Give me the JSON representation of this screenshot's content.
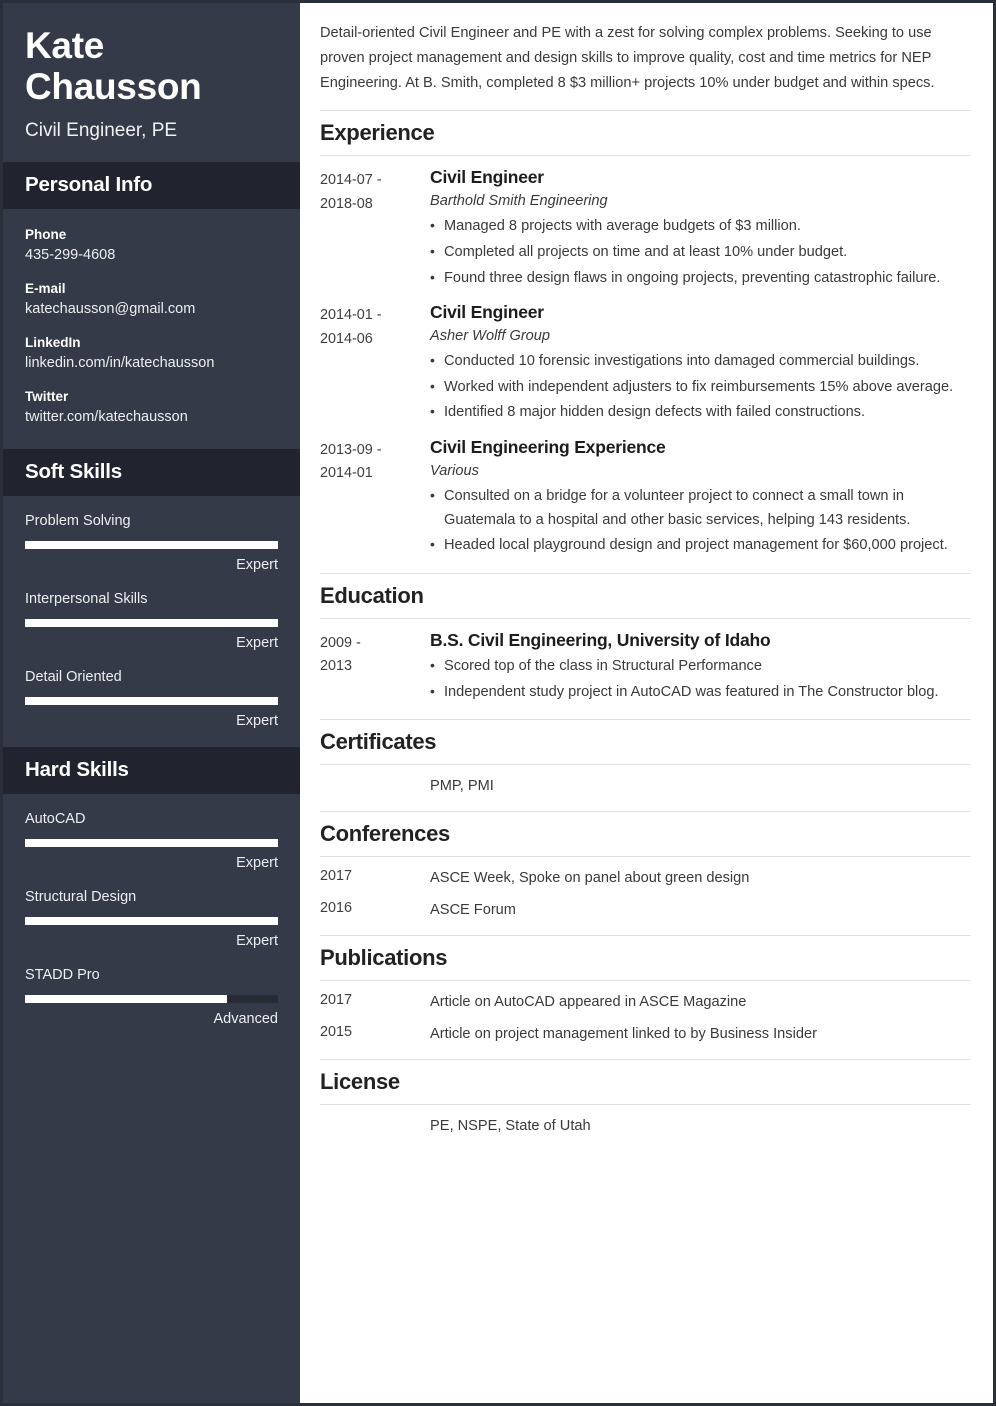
{
  "sidebar": {
    "name": "Kate Chausson",
    "job_title": "Civil Engineer, PE",
    "personal_info": {
      "heading": "Personal Info",
      "items": [
        {
          "label": "Phone",
          "value": "435-299-4608"
        },
        {
          "label": "E-mail",
          "value": "katechausson@gmail.com"
        },
        {
          "label": "LinkedIn",
          "value": "linkedin.com/in/katechausson"
        },
        {
          "label": "Twitter",
          "value": "twitter.com/katechausson"
        }
      ]
    },
    "soft_skills": {
      "heading": "Soft Skills",
      "items": [
        {
          "name": "Problem Solving",
          "level": "Expert",
          "percent": 100
        },
        {
          "name": "Interpersonal Skills",
          "level": "Expert",
          "percent": 100
        },
        {
          "name": "Detail Oriented",
          "level": "Expert",
          "percent": 100
        }
      ]
    },
    "hard_skills": {
      "heading": "Hard Skills",
      "items": [
        {
          "name": "AutoCAD",
          "level": "Expert",
          "percent": 100
        },
        {
          "name": "Structural Design",
          "level": "Expert",
          "percent": 100
        },
        {
          "name": "STADD Pro",
          "level": "Advanced",
          "percent": 80
        }
      ]
    }
  },
  "main": {
    "summary": "Detail-oriented Civil Engineer and PE with a zest for solving complex problems. Seeking to use proven project management and design skills to improve quality, cost and time metrics for NEP Engineering. At B. Smith, completed 8 $3 million+ projects 10% under budget and within specs.",
    "experience": {
      "heading": "Experience",
      "entries": [
        {
          "date_start": "2014-07 -",
          "date_end": "2018-08",
          "title": "Civil Engineer",
          "org": "Barthold Smith Engineering",
          "bullets": [
            "Managed 8 projects with average budgets of $3 million.",
            "Completed all projects on time and at least 10% under budget.",
            "Found three design flaws in ongoing projects, preventing catastrophic failure."
          ]
        },
        {
          "date_start": "2014-01 -",
          "date_end": "2014-06",
          "title": "Civil Engineer",
          "org": "Asher Wolff Group",
          "bullets": [
            "Conducted 10 forensic investigations into damaged commercial buildings.",
            "Worked with independent adjusters to fix reimbursements 15% above average.",
            "Identified 8 major hidden design defects with failed constructions."
          ]
        },
        {
          "date_start": "2013-09 -",
          "date_end": "2014-01",
          "title": "Civil Engineering Experience",
          "org": "Various",
          "bullets": [
            "Consulted on a bridge for a volunteer project to connect a small town in Guatemala to a hospital and other basic services, helping 143 residents.",
            "Headed local playground design and project management for $60,000 project."
          ]
        }
      ]
    },
    "education": {
      "heading": "Education",
      "entries": [
        {
          "date_start": "2009 -",
          "date_end": "2013",
          "title": "B.S. Civil Engineering, University of Idaho",
          "bullets": [
            "Scored top of the class in Structural Performance",
            "Independent study project in AutoCAD was featured in The Constructor blog."
          ]
        }
      ]
    },
    "certificates": {
      "heading": "Certificates",
      "entries": [
        {
          "date": "",
          "text": "PMP, PMI"
        }
      ]
    },
    "conferences": {
      "heading": "Conferences",
      "entries": [
        {
          "date": "2017",
          "text": "ASCE Week, Spoke on panel about green design"
        },
        {
          "date": "2016",
          "text": "ASCE Forum"
        }
      ]
    },
    "publications": {
      "heading": "Publications",
      "entries": [
        {
          "date": "2017",
          "text": "Article on AutoCAD appeared in ASCE Magazine"
        },
        {
          "date": "2015",
          "text": "Article on project management linked to by Business Insider"
        }
      ]
    },
    "license": {
      "heading": "License",
      "entries": [
        {
          "date": "",
          "text": "PE, NSPE, State of Utah"
        }
      ]
    }
  },
  "colors": {
    "sidebar_bg": "#343a47",
    "sidebar_band_bg": "#21242e",
    "skill_fill": "#ffffff",
    "skill_track": "#272b35",
    "rule": "#e2e2e2"
  }
}
